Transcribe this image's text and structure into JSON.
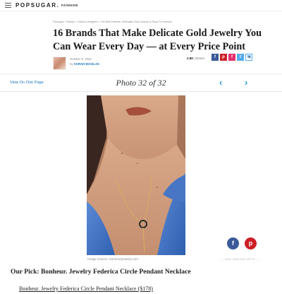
{
  "header": {
    "brand": "POPSUGAR.",
    "section": "FASHION"
  },
  "article": {
    "breadcrumb": "Popsugar › Fashion › Fashion Designers › The Best Delicate, Minimalist Gold Jewelry to Shop For Women",
    "title": "16 Brands That Make Delicate Gold Jewelry You Can Wear Every Day — at Every Price Point",
    "date": "October 9, 2020",
    "byline_prefix": "by",
    "author": "SARAH WASILAK",
    "share_count": "2.8K",
    "share_label": "Shares"
  },
  "share_icons": [
    "facebook-icon",
    "pinterest-icon",
    "flipboard-icon",
    "twitter-icon",
    "email-icon",
    "plus-icon"
  ],
  "gallery": {
    "view_one_page": "View On One Page",
    "photo_counter": "Photo 32 of 32",
    "prev_glyph": "‹",
    "next_glyph": "›",
    "image_source": "Image Source: bonheurjewelry.com",
    "arrow_hint": "← USE ARROW KEYS →"
  },
  "floating_share": {
    "facebook_glyph": "f",
    "pinterest_glyph": "p"
  },
  "product": {
    "pick_label": "Our Pick: Bonheur. Jewelry Federica Circle Pendant Necklace",
    "link_text": "Bonheur. Jewelry Federica Circle Pendant Necklace ($178)"
  },
  "colors": {
    "link_blue": "#1a73c8",
    "arrow_blue": "#2b9fd6",
    "facebook": "#3b5998",
    "pinterest": "#cb2027"
  }
}
